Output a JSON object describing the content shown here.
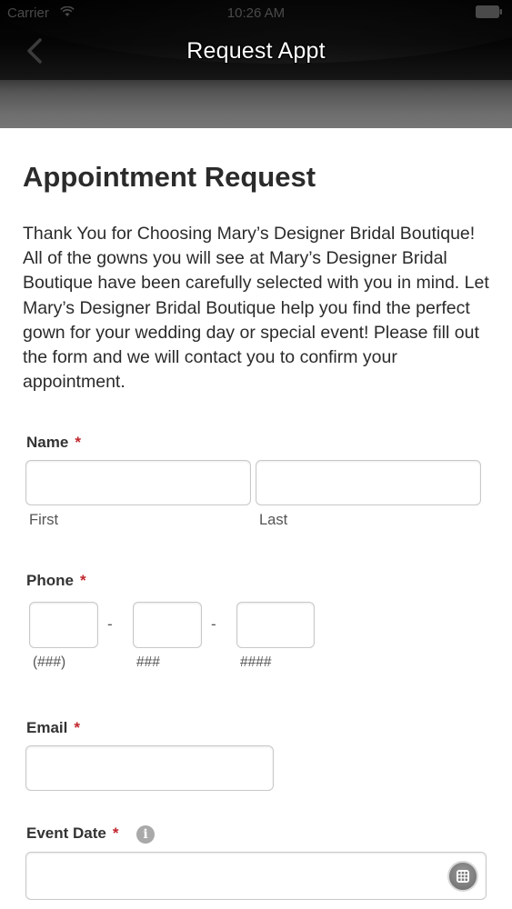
{
  "status_bar": {
    "carrier": "Carrier",
    "time": "10:26 AM"
  },
  "nav": {
    "title": "Request Appt"
  },
  "form": {
    "heading": "Appointment Request",
    "intro": "Thank You for Choosing Mary’s Designer Bridal Boutique! All of the gowns you will see at Mary’s Designer Bridal Boutique have been carefully selected with you in mind. Let Mary’s Designer Bridal Boutique help you find the perfect gown for your wedding day or special event! Please fill out the form and we will contact you to confirm your appointment.",
    "required_marker": "*",
    "name": {
      "label": "Name",
      "first_label": "First",
      "last_label": "Last",
      "first_value": "",
      "last_value": ""
    },
    "phone": {
      "label": "Phone",
      "separator": "-",
      "area_label": "(###)",
      "prefix_label": "###",
      "line_label": "####",
      "area_value": "",
      "prefix_value": "",
      "line_value": ""
    },
    "email": {
      "label": "Email",
      "value": ""
    },
    "event_date": {
      "label": "Event Date",
      "value": ""
    }
  },
  "icons": {
    "back": "chevron-left-icon",
    "wifi": "wifi-icon",
    "battery": "battery-icon",
    "info": "info-icon",
    "calendar": "calendar-grid-icon"
  },
  "colors": {
    "required": "#c0272d",
    "appbar": "#000000",
    "subbar": "#6e6e6e"
  }
}
